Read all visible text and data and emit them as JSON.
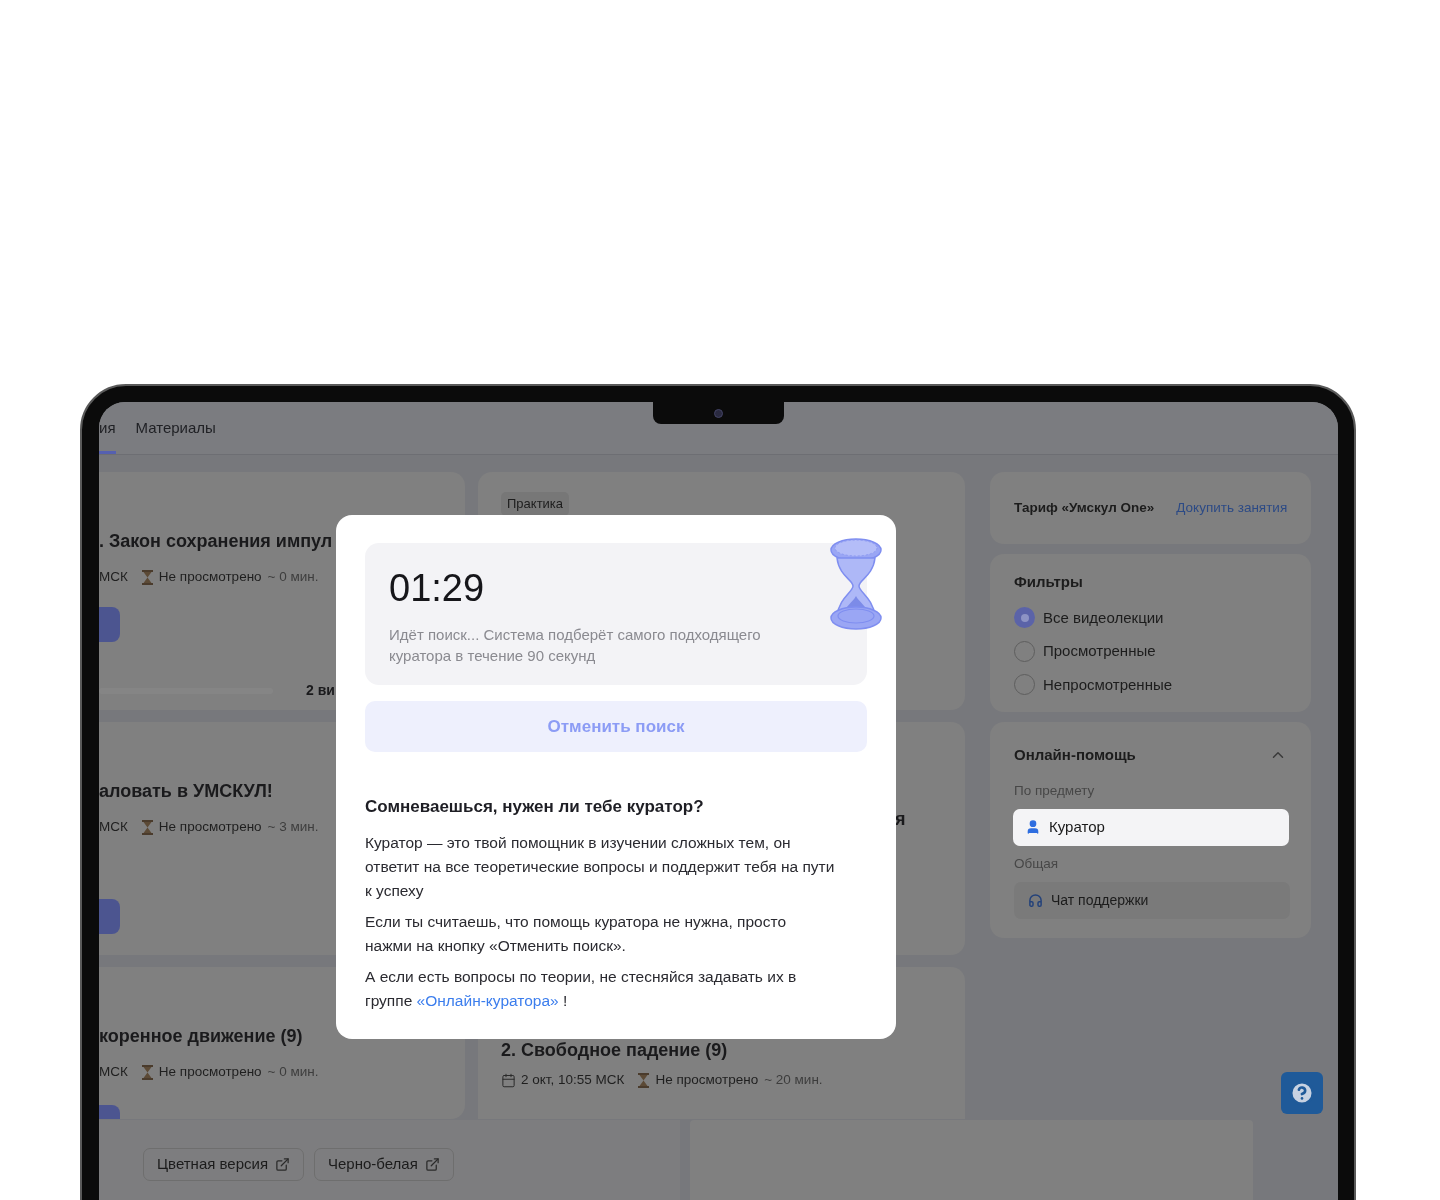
{
  "tabs": [
    {
      "label": "ия",
      "selected": true
    },
    {
      "label": "Материалы",
      "selected": false
    }
  ],
  "left_cards": [
    {
      "title": ". Закон сохранения импул",
      "date": "МСК",
      "status": "Не просмотрено",
      "duration": "~ 0 мин.",
      "progress": {
        "label": "2 ви"
      }
    },
    {
      "title": "аловать в УМСКУЛ!",
      "date": "МСК",
      "status": "Не просмотрено",
      "duration": "~ 3 мин."
    },
    {
      "title": "коренное движение (9)",
      "date": "МСК",
      "status": "Не просмотрено",
      "duration": "~ 0 мин."
    }
  ],
  "middle_cards": [
    {
      "tag": "Практика"
    },
    {
      "title": "я"
    },
    {
      "title": "2. Свободное падение (9)",
      "date": "2 окт, 10:55 МСК",
      "status": "Не просмотрено",
      "duration": "~ 20 мин."
    }
  ],
  "downloads": [
    {
      "label": "Цветная версия"
    },
    {
      "label": "Черно-белая"
    }
  ],
  "tariff": {
    "label": "Тариф «Умскул One»",
    "link": "Докупить занятия"
  },
  "filters": {
    "title": "Фильтры",
    "options": [
      {
        "label": "Все видеолекции",
        "selected": true
      },
      {
        "label": "Просмотренные",
        "selected": false
      },
      {
        "label": "Непросмотренные",
        "selected": false
      }
    ]
  },
  "online_help": {
    "title": "Онлайн-помощь",
    "expanded": true,
    "groups": [
      {
        "label": "По предмету",
        "items": [
          {
            "label": "Куратор",
            "kind": "curator",
            "highlighted": true
          }
        ]
      },
      {
        "label": "Общая",
        "items": [
          {
            "label": "Чат поддержки",
            "kind": "support",
            "highlighted": false
          }
        ]
      }
    ]
  },
  "modal": {
    "timer": "01:29",
    "status": "Идёт поиск... Система подберёт самого подходящего куратора в течение 90 секунд",
    "cancel": "Отменить поиск",
    "heading": "Сомневаешься, нужен ли тебе куратор?",
    "paragraphs": [
      {
        "text": "Куратор — это твой помощник в изучении сложных тем, он ответит на все теоретические вопросы и поддержит тебя на пути к успеху"
      },
      {
        "text": "Если ты считаешь, что помощь куратора не нужна, просто нажми на кнопку «Отменить поиск»."
      },
      {
        "text": "А если есть вопросы по теории, не стесняйся задавать их в группе ",
        "link": "«Онлайн-куратора»",
        "after": " !"
      }
    ]
  }
}
